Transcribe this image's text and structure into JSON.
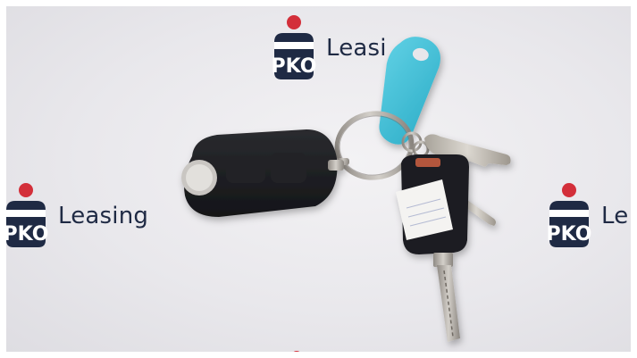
{
  "photo": {
    "logo_word": "Leasing",
    "logo_word_cropped": "Leasi",
    "logo_word_right_cropped": "Le",
    "colors": {
      "backdrop": "#ecebee",
      "brand_red": "#d32f3a",
      "brand_navy": "#1f2a44",
      "tag_blue": "#3fbfd6",
      "fob_black": "#1b1c1f",
      "metal": "#b8b4ae"
    },
    "objects": [
      "pko-leasing-logo",
      "car-key-fob",
      "key-ring",
      "blue-key-tag",
      "paper-label-key",
      "brass-key"
    ]
  }
}
